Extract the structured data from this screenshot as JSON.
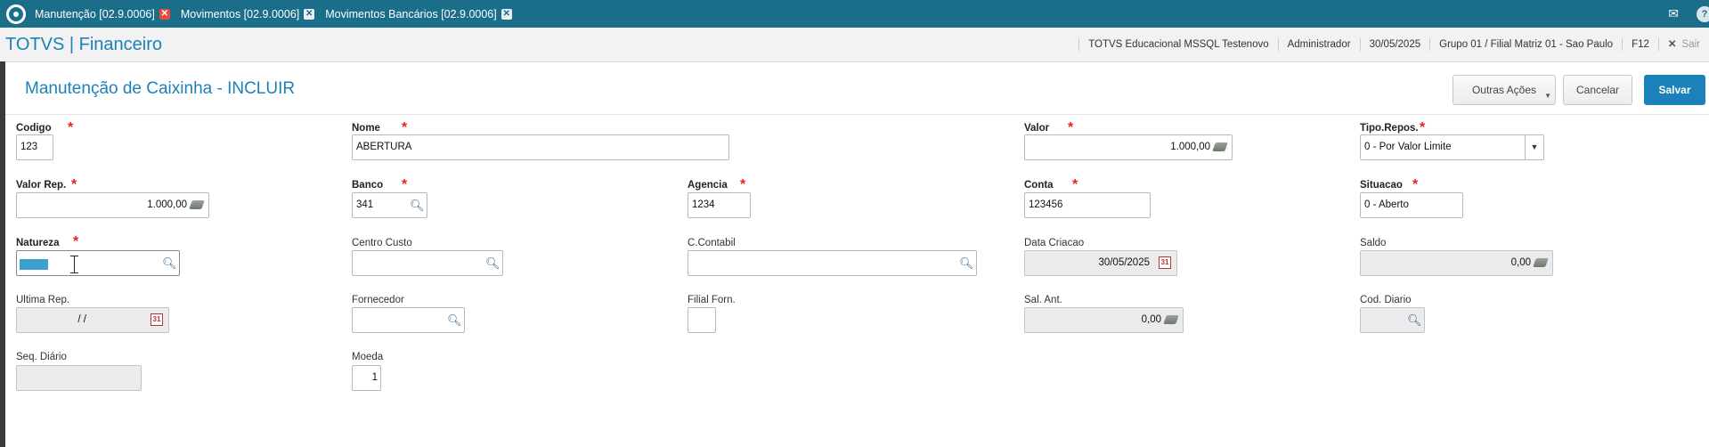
{
  "tabs": [
    {
      "label": "Manutenção [02.9.0006]",
      "active": true
    },
    {
      "label": "Movimentos [02.9.0006]",
      "active": false
    },
    {
      "label": "Movimentos Bancários [02.9.0006]",
      "active": false
    }
  ],
  "app": {
    "brand": "TOTVS | Financeiro"
  },
  "info": {
    "environment": "TOTVS Educacional MSSQL Testenovo",
    "user": "Administrador",
    "date": "30/05/2025",
    "branch": "Grupo 01 / Filial Matriz 01 - Sao Paulo",
    "shortcut": "F12",
    "exit_label": "Sair"
  },
  "page": {
    "title": "Manutenção de Caixinha - INCLUIR"
  },
  "actions": {
    "more": "Outras Ações",
    "cancel": "Cancelar",
    "save": "Salvar"
  },
  "fields": {
    "codigo": {
      "label": "Codigo",
      "value": "123"
    },
    "nome": {
      "label": "Nome",
      "value": "ABERTURA"
    },
    "valor": {
      "label": "Valor",
      "value": "1.000,00"
    },
    "tipo_repos": {
      "label": "Tipo.Repos.",
      "value": "0 - Por Valor Limite"
    },
    "valor_rep": {
      "label": "Valor Rep.",
      "value": "1.000,00"
    },
    "banco": {
      "label": "Banco",
      "value": "341"
    },
    "agencia": {
      "label": "Agencia",
      "value": "1234"
    },
    "conta": {
      "label": "Conta",
      "value": "123456"
    },
    "situacao": {
      "label": "Situacao",
      "value": "0 - Aberto"
    },
    "natureza": {
      "label": "Natureza",
      "value": ""
    },
    "centro_custo": {
      "label": "Centro Custo",
      "value": ""
    },
    "c_contabil": {
      "label": "C.Contabil",
      "value": ""
    },
    "data_criacao": {
      "label": "Data Criacao",
      "value": "30/05/2025"
    },
    "saldo": {
      "label": "Saldo",
      "value": "0,00"
    },
    "ultima_rep": {
      "label": "Ultima Rep.",
      "value": "/ /"
    },
    "fornecedor": {
      "label": "Fornecedor",
      "value": ""
    },
    "filial_forn": {
      "label": "Filial Forn.",
      "value": ""
    },
    "sal_ant": {
      "label": "Sal. Ant.",
      "value": "0,00"
    },
    "cod_diario": {
      "label": "Cod. Diario",
      "value": ""
    },
    "seq_diario": {
      "label": "Seq. Diário",
      "value": ""
    },
    "moeda": {
      "label": "Moeda",
      "value": "1"
    }
  },
  "colors": {
    "topbar": "#1a6e8a",
    "accent": "#1a82b8",
    "required": "#e21"
  }
}
